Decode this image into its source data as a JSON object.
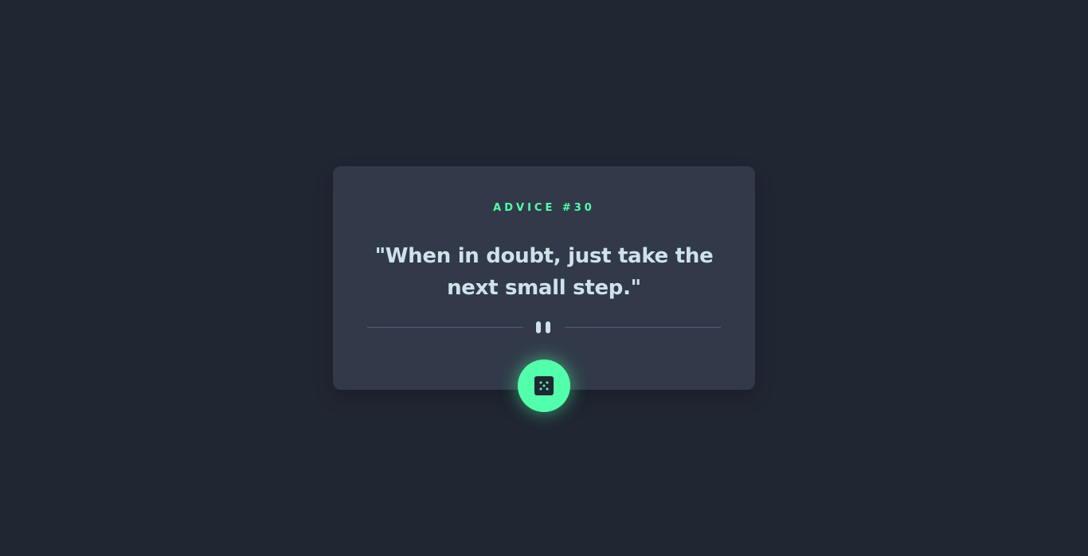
{
  "advice": {
    "label": "ADVICE #30",
    "quote": "\"When in doubt, just take the next small step.\""
  },
  "icons": {
    "divider": "pause-icon",
    "button": "dice-icon"
  },
  "colors": {
    "background": "#202632",
    "card": "#323a49",
    "accent": "#53ffaa",
    "text": "#cee3e9",
    "divider": "#4f5d74"
  }
}
